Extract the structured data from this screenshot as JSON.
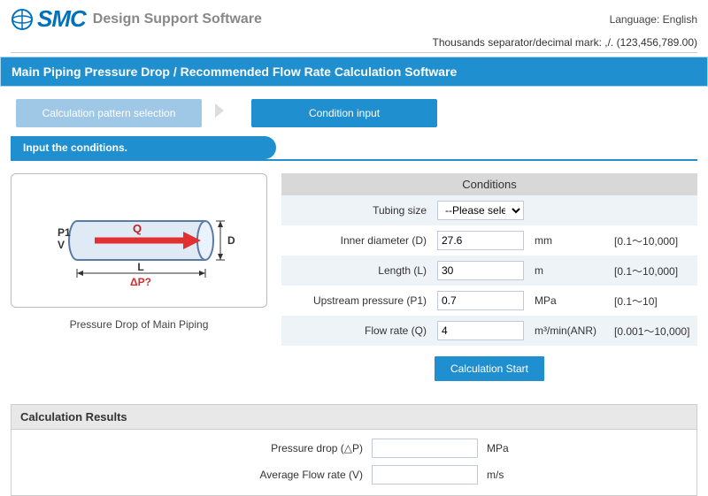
{
  "header": {
    "brand": "SMC",
    "product": "Design Support Software",
    "language_label": "Language:",
    "language_value": "English",
    "sep_note": "Thousands separator/decimal mark: ,/. (123,456,789.00)"
  },
  "title": "Main Piping Pressure Drop / Recommended Flow Rate Calculation Software",
  "steps": {
    "pattern": "Calculation pattern selection",
    "input": "Condition input"
  },
  "cond_bar": "Input the conditions.",
  "diagram": {
    "P1": "P1",
    "V": "V",
    "Q": "Q",
    "D": "D",
    "L": "L",
    "dP": "ΔP?",
    "caption": "Pressure Drop of Main Piping"
  },
  "conditions": {
    "heading": "Conditions",
    "rows": {
      "tubing": {
        "label": "Tubing size",
        "value": "--Please select--"
      },
      "inner_d": {
        "label": "Inner diameter (D)",
        "value": "27.6",
        "unit": "mm",
        "range": "[0.1～10,000]"
      },
      "length": {
        "label": "Length (L)",
        "value": "30",
        "unit": "m",
        "range": "[0.1～10,000]"
      },
      "upstream": {
        "label": "Upstream pressure (P1)",
        "value": "0.7",
        "unit": "MPa",
        "range": "[0.1～10]"
      },
      "flow": {
        "label": "Flow rate (Q)",
        "value": "4",
        "unit": "m³/min(ANR)",
        "range": "[0.001～10,000]"
      }
    },
    "calc_button": "Calculation Start"
  },
  "results": {
    "heading": "Calculation Results",
    "pressure_drop": {
      "label": "Pressure drop (△P)",
      "value": "",
      "unit": "MPa"
    },
    "avg_flow": {
      "label": "Average Flow rate (V)",
      "value": "",
      "unit": "m/s"
    }
  }
}
